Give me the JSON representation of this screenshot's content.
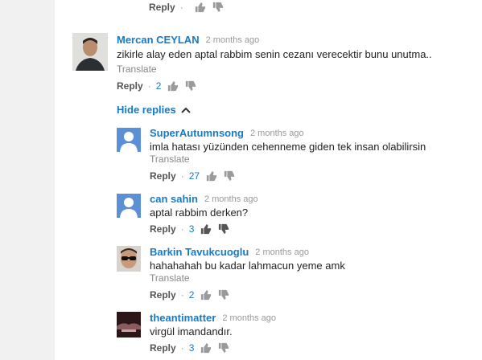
{
  "top_action": {
    "reply_label": "Reply"
  },
  "comment": {
    "author": "Mercan CEYLAN",
    "time": "2 months ago",
    "text": "zikirle alay eden aptal rabbim senin cezanı verecektir bunu unutma..",
    "translate": "Translate",
    "reply_label": "Reply",
    "likes": "2"
  },
  "hide_replies_label": "Hide replies",
  "replies": [
    {
      "author": "SuperAutumnsong",
      "time": "2 months ago",
      "text": "imla hatası yüzünden cehenneme giden tek insan olabilirsin",
      "translate": "Translate",
      "reply_label": "Reply",
      "likes": "27"
    },
    {
      "author": "can sahin",
      "time": "2 months ago",
      "text": "aptal rabbim derken?",
      "reply_label": "Reply",
      "likes": "3"
    },
    {
      "author": "Barkin Tavukcuoglu",
      "time": "2 months ago",
      "text": "hahahahah bu kadar lahmacun yeme amk",
      "translate": "Translate",
      "reply_label": "Reply",
      "likes": "2"
    },
    {
      "author": "theantimatter",
      "time": "2 months ago",
      "text": "virgül imandandır.",
      "reply_label": "Reply",
      "likes": "3"
    }
  ]
}
